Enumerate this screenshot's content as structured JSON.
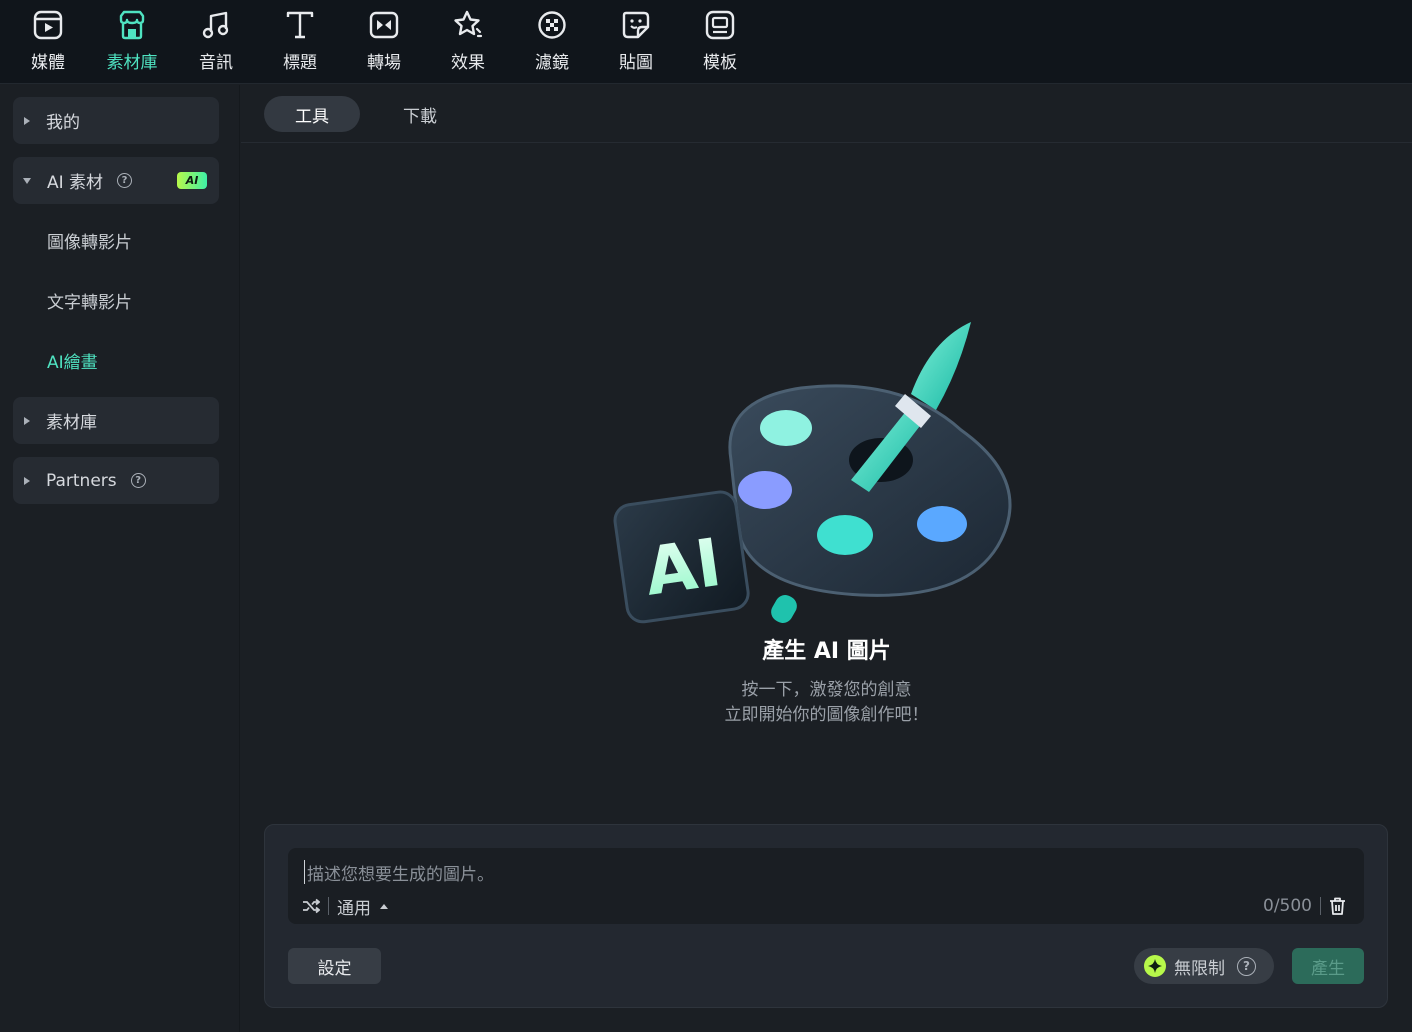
{
  "toolbar": {
    "items": [
      {
        "label": "媒體",
        "icon": "media-icon"
      },
      {
        "label": "素材庫",
        "icon": "stock-library-icon",
        "active": true
      },
      {
        "label": "音訊",
        "icon": "music-note-icon"
      },
      {
        "label": "標題",
        "icon": "title-t-icon"
      },
      {
        "label": "轉場",
        "icon": "transition-icon"
      },
      {
        "label": "效果",
        "icon": "effects-star-icon"
      },
      {
        "label": "濾鏡",
        "icon": "filter-icon"
      },
      {
        "label": "貼圖",
        "icon": "sticker-icon"
      },
      {
        "label": "模板",
        "icon": "template-icon"
      }
    ]
  },
  "sidebar": {
    "mine": "我的",
    "ai_assets": "AI 素材",
    "ai_badge": "AI",
    "sub_items": [
      "圖像轉影片",
      "文字轉影片",
      "AI繪畫"
    ],
    "stock": "素材庫",
    "partners": "Partners",
    "help_glyph": "?"
  },
  "tabs": {
    "tools": "工具",
    "download": "下載"
  },
  "hero": {
    "title": "產生 AI 圖片",
    "line1": "按一下，激發您的創意",
    "line2": "立即開始你的圖像創作吧！",
    "logo_text": "AI"
  },
  "prompt": {
    "placeholder": "描述您想要生成的圖片。",
    "style": "通用",
    "counter": "0/500"
  },
  "actions": {
    "settings": "設定",
    "unlimited": "無限制",
    "generate": "產生"
  },
  "colors": {
    "accent": "#4fe3c1",
    "badge": "#b7f84a"
  }
}
